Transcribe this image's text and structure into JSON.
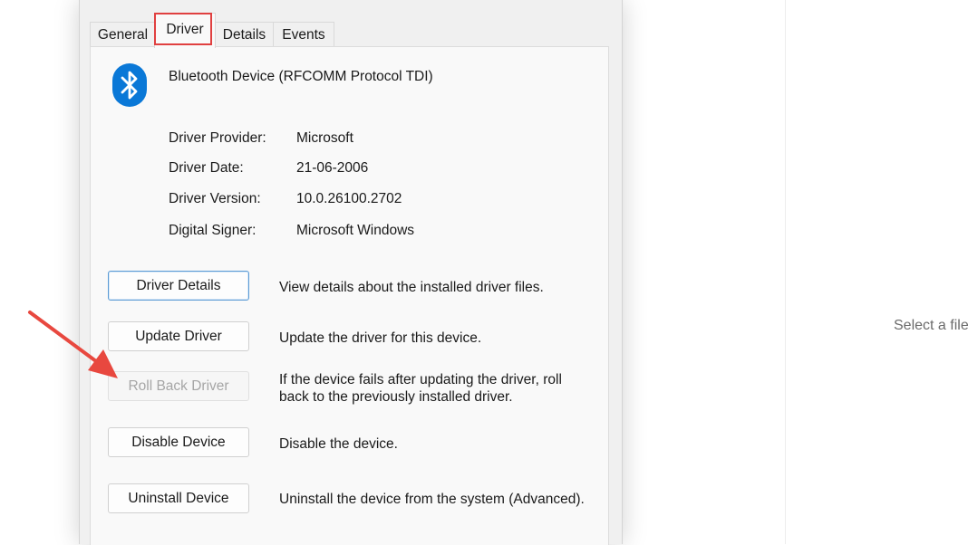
{
  "tabs": [
    {
      "label": "General",
      "active": false
    },
    {
      "label": "Driver",
      "active": true
    },
    {
      "label": "Details",
      "active": false
    },
    {
      "label": "Events",
      "active": false
    }
  ],
  "device": {
    "icon": "bluetooth-icon",
    "name": "Bluetooth Device (RFCOMM Protocol TDI)"
  },
  "driver_info": {
    "provider_label": "Driver Provider:",
    "provider_value": "Microsoft",
    "date_label": "Driver Date:",
    "date_value": "21-06-2006",
    "version_label": "Driver Version:",
    "version_value": "10.0.26100.2702",
    "signer_label": "Digital Signer:",
    "signer_value": "Microsoft Windows"
  },
  "actions": {
    "details_button": "Driver Details",
    "details_desc": "View details about the installed driver files.",
    "update_button": "Update Driver",
    "update_desc": "Update the driver for this device.",
    "rollback_button": "Roll Back Driver",
    "rollback_desc_line1": "If the device fails after updating the driver, roll",
    "rollback_desc_line2": "back to the previously installed driver.",
    "disable_button": "Disable Device",
    "disable_desc": "Disable the device.",
    "uninstall_button": "Uninstall Device",
    "uninstall_desc": "Uninstall the device from the system (Advanced)."
  },
  "right_pane": {
    "placeholder": "Select a file"
  },
  "colors": {
    "highlight": "#e04040",
    "bluetooth_blue": "#0a78d7"
  }
}
